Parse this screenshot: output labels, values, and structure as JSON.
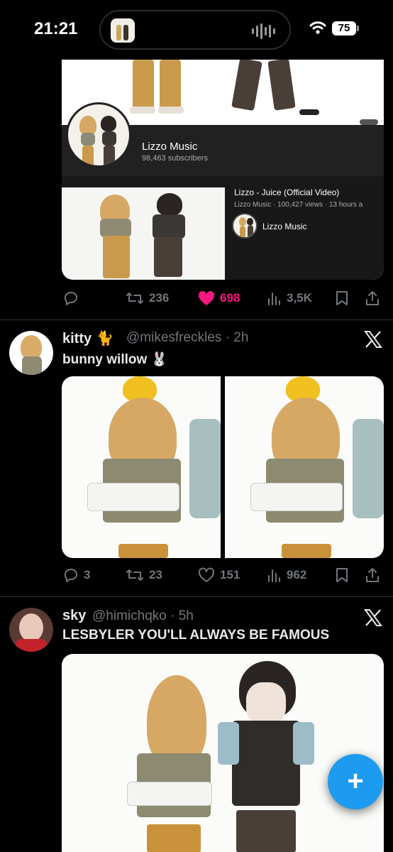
{
  "status_bar": {
    "time": "21:21",
    "battery": "75"
  },
  "embed": {
    "channel_name": "Lizzo Music",
    "subscribers": "98,463 subscribers",
    "video_title": "Lizzo - Juice (Official Video)",
    "video_meta": "Lizzo Music · 100,427 views · 13 hours a",
    "video_channel": "Lizzo Music"
  },
  "tweets": [
    {
      "actions": {
        "reply": "",
        "retweet": "236",
        "like": "698",
        "views": "3,5K"
      }
    },
    {
      "display_name": "kitty",
      "name_emoji": "🐈",
      "handle": "@mikesfreckles",
      "time": "· 2h",
      "text": "bunny willow",
      "text_emoji": "🐰",
      "actions": {
        "reply": "3",
        "retweet": "23",
        "like": "151",
        "views": "962"
      }
    },
    {
      "display_name": "sky",
      "handle": "@himichqko",
      "time": "· 5h",
      "text": "LESBYLER YOU'LL ALWAYS BE FAMOUS"
    }
  ],
  "colors": {
    "like": "#f91880",
    "accent": "#1d9bf0",
    "muted": "#71767b"
  },
  "icons": [
    "reply-icon",
    "retweet-icon",
    "heart-icon",
    "views-icon",
    "bookmark-icon",
    "share-icon",
    "x-logo-icon",
    "compose-plus-icon"
  ]
}
